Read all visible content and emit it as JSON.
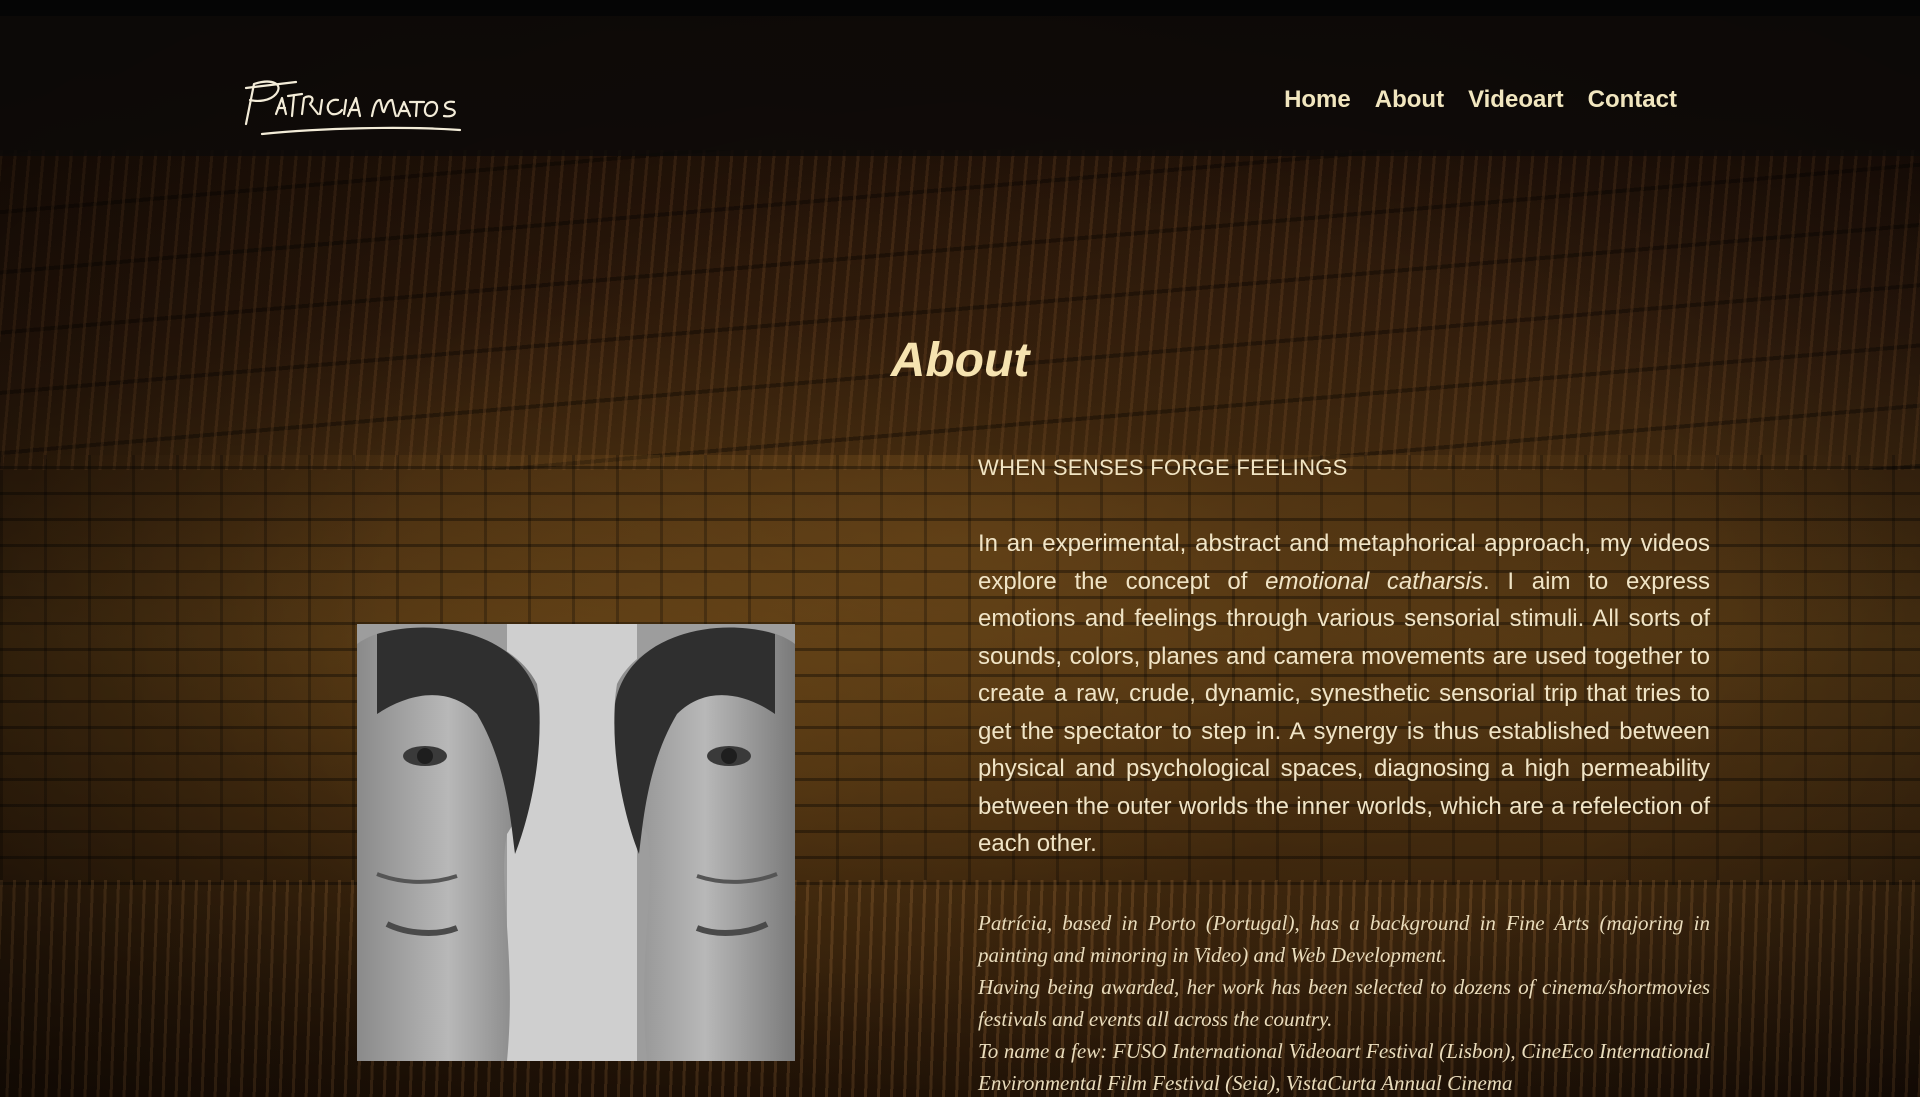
{
  "header": {
    "logo_text": "Patricia Matos",
    "nav": [
      "Home",
      "About",
      "Videoart",
      "Contact"
    ]
  },
  "main": {
    "title": "About",
    "subtitle": "WHEN SENSES FORGE FEELINGS",
    "intro_before": "In an experimental, abstract and metaphorical approach, my videos explore the concept of ",
    "intro_em": "emotional catharsis",
    "intro_after": ". I aim to express emotions and feelings through various sensorial stimuli. All sorts of sounds, colors, planes and camera movements are used together to create a raw, crude, dynamic, synesthetic sensorial trip that tries to get the spectator to step in. A synergy is thus established between physical and psychological spaces, diagnosing a high permeability between the outer worlds the inner worlds, which are a refelection of each other.",
    "bio_1": "Patrícia, based in Porto (Portugal), has a background in Fine Arts (majoring in painting and minoring in Video) and Web Development.",
    "bio_2": "Having being awarded, her work has been selected to dozens of cinema/shortmovies festivals and events all across the country.",
    "bio_3": "To name a few: FUSO International Videoart Festival (Lisbon), CineEco International Environmental Film Festival (Seia), VistaCurta Annual Cinema"
  },
  "colors": {
    "accent": "#f6e3b0",
    "text": "#f0e4c6",
    "header_bg": "#0c0a08"
  }
}
